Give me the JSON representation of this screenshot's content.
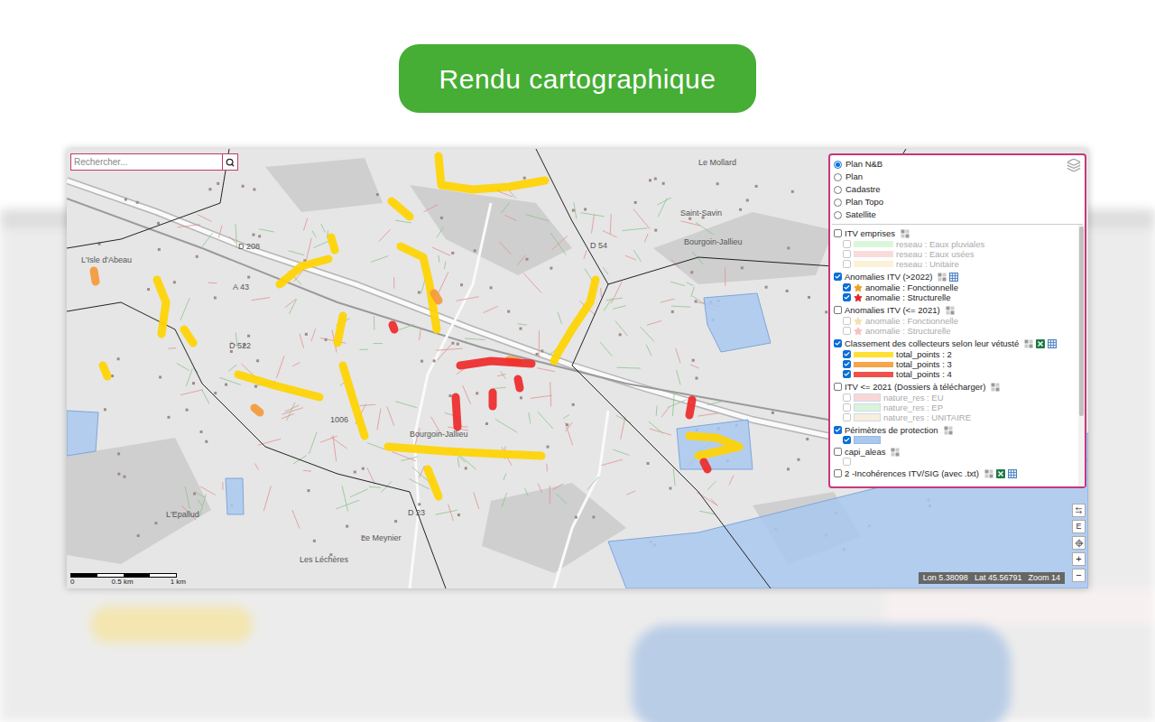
{
  "banner": {
    "label": "Rendu cartographique"
  },
  "search": {
    "placeholder": "Rechercher..."
  },
  "basemaps": [
    {
      "label": "Plan N&B",
      "selected": true
    },
    {
      "label": "Plan",
      "selected": false
    },
    {
      "label": "Cadastre",
      "selected": false
    },
    {
      "label": "Plan Topo",
      "selected": false
    },
    {
      "label": "Satellite",
      "selected": false
    }
  ],
  "layers": [
    {
      "name": "ITV emprises",
      "checked": false,
      "tools": [
        "grid"
      ],
      "items": [
        {
          "label": "reseau : Eaux pluviales",
          "checked": false,
          "disabled": true,
          "kind": "band",
          "color": "#b8efb8"
        },
        {
          "label": "reseau : Eaux usées",
          "checked": false,
          "disabled": true,
          "kind": "band",
          "color": "#f6b8b8"
        },
        {
          "label": "reseau : Unitaire",
          "checked": false,
          "disabled": true,
          "kind": "band",
          "color": "#f7e6b0"
        }
      ]
    },
    {
      "name": "Anomalies ITV (>2022)",
      "checked": true,
      "tools": [
        "grid",
        "table"
      ],
      "items": [
        {
          "label": "anomalie : Fonctionnelle",
          "checked": true,
          "disabled": false,
          "kind": "star",
          "color": "#f0a020"
        },
        {
          "label": "anomalie : Structurelle",
          "checked": true,
          "disabled": false,
          "kind": "star",
          "color": "#e02828"
        }
      ]
    },
    {
      "name": "Anomalies ITV (<= 2021)",
      "checked": false,
      "tools": [
        "grid"
      ],
      "items": [
        {
          "label": "anomalie : Fonctionnelle",
          "checked": false,
          "disabled": true,
          "kind": "star",
          "color": "#f0c060"
        },
        {
          "label": "anomalie : Structurelle",
          "checked": false,
          "disabled": true,
          "kind": "star",
          "color": "#f08080"
        }
      ]
    },
    {
      "name": "Classement des collecteurs selon leur vétusté",
      "checked": true,
      "tools": [
        "grid",
        "excel",
        "table"
      ],
      "items": [
        {
          "label": "total_points : 2",
          "checked": true,
          "disabled": false,
          "kind": "line",
          "color": "#ffe033"
        },
        {
          "label": "total_points : 3",
          "checked": true,
          "disabled": false,
          "kind": "line",
          "color": "#f5a54a"
        },
        {
          "label": "total_points : 4",
          "checked": true,
          "disabled": false,
          "kind": "line",
          "color": "#f0504a"
        }
      ]
    },
    {
      "name": "ITV <= 2021 (Dossiers à télécharger)",
      "checked": false,
      "tools": [
        "grid"
      ],
      "items": [
        {
          "label": "nature_res : EU",
          "checked": false,
          "disabled": true,
          "kind": "fill",
          "color": "#f4b0b0"
        },
        {
          "label": "nature_res : EP",
          "checked": false,
          "disabled": true,
          "kind": "fill",
          "color": "#b8e8b8"
        },
        {
          "label": "nature_res : UNITAIRE",
          "checked": false,
          "disabled": true,
          "kind": "fill",
          "color": "#f0e0b8"
        }
      ]
    },
    {
      "name": "Périmètres de protection",
      "checked": true,
      "tools": [
        "grid"
      ],
      "items": [
        {
          "label": "",
          "checked": true,
          "disabled": false,
          "kind": "fill",
          "color": "#a9c8f0"
        }
      ]
    },
    {
      "name": "capi_aleas",
      "checked": false,
      "tools": [
        "grid"
      ],
      "items": [
        {
          "label": "",
          "checked": false,
          "disabled": true,
          "kind": "none",
          "color": "#ffffff"
        }
      ]
    },
    {
      "name": "2 -Incohérences ITV/SIG (avec .txt)",
      "checked": false,
      "tools": [
        "grid",
        "excel",
        "table"
      ],
      "items": []
    }
  ],
  "collectors": [
    {
      "color": "#ffd400"
    },
    {
      "color": "#ffd400"
    },
    {
      "color": "#ffd400"
    },
    {
      "color": "#ffd400"
    },
    {
      "color": "#ffd400"
    },
    {
      "color": "#ffd400"
    },
    {
      "color": "#ffd400"
    },
    {
      "color": "#ffd400"
    },
    {
      "color": "#ffd400"
    },
    {
      "color": "#ffd400"
    },
    {
      "color": "#ffd400"
    },
    {
      "color": "#ffd400"
    },
    {
      "color": "#ffd400"
    },
    {
      "color": "#ffd400"
    },
    {
      "color": "#ffd400"
    },
    {
      "color": "#f59a3c"
    },
    {
      "color": "#f59a3c"
    },
    {
      "color": "#f59a3c"
    },
    {
      "color": "#f59a3c"
    },
    {
      "color": "#ee2a2a"
    },
    {
      "color": "#ee2a2a"
    },
    {
      "color": "#ee2a2a"
    },
    {
      "color": "#ee2a2a"
    },
    {
      "color": "#ee2a2a"
    },
    {
      "color": "#ee2a2a"
    },
    {
      "color": "#ee2a2a"
    }
  ],
  "map_labels": [
    "L'Isle d'Abeau",
    "A 43",
    "D 208",
    "D 522",
    "Bourgoin-Jallieu",
    "1006",
    "D 23",
    "L'Epallud",
    "Les Léchères",
    "Le Meynier",
    "Le Mollard",
    "D 54",
    "Bourgoin-Jallieu",
    "Saint-Savin"
  ],
  "scale": {
    "ticks": [
      "0",
      "0.5 km",
      "1 km"
    ]
  },
  "controls": {
    "edit": "E",
    "zoom_in": "+",
    "zoom_out": "−"
  },
  "coords": {
    "lon_label": "Lon",
    "lon": "5.38098",
    "lat_label": "Lat",
    "lat": "45.56791",
    "zoom_label": "Zoom",
    "zoom": "14"
  }
}
